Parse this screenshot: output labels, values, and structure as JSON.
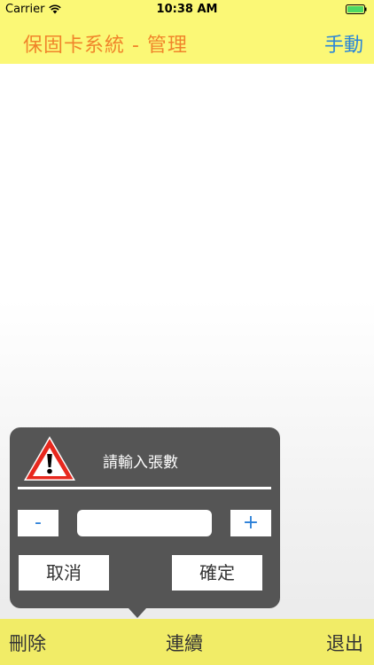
{
  "status_bar": {
    "carrier": "Carrier",
    "time": "10:38 AM",
    "wifi_icon": "wifi-icon",
    "battery_icon": "battery-icon",
    "battery_color": "#4cd964"
  },
  "nav_bar": {
    "title": "保固卡系統 - 管理",
    "right_button": "手動",
    "background": "#fbf876",
    "title_color": "#f0842a",
    "button_color": "#2a86d8"
  },
  "popup": {
    "icon": "warning-icon",
    "title": "請輸入張數",
    "minus_label": "-",
    "plus_label": "+",
    "count_value": "",
    "cancel_label": "取消",
    "confirm_label": "確定",
    "background": "#555555"
  },
  "toolbar": {
    "delete_label": "刪除",
    "continue_label": "連續",
    "exit_label": "退出",
    "background": "#f1ec67"
  }
}
